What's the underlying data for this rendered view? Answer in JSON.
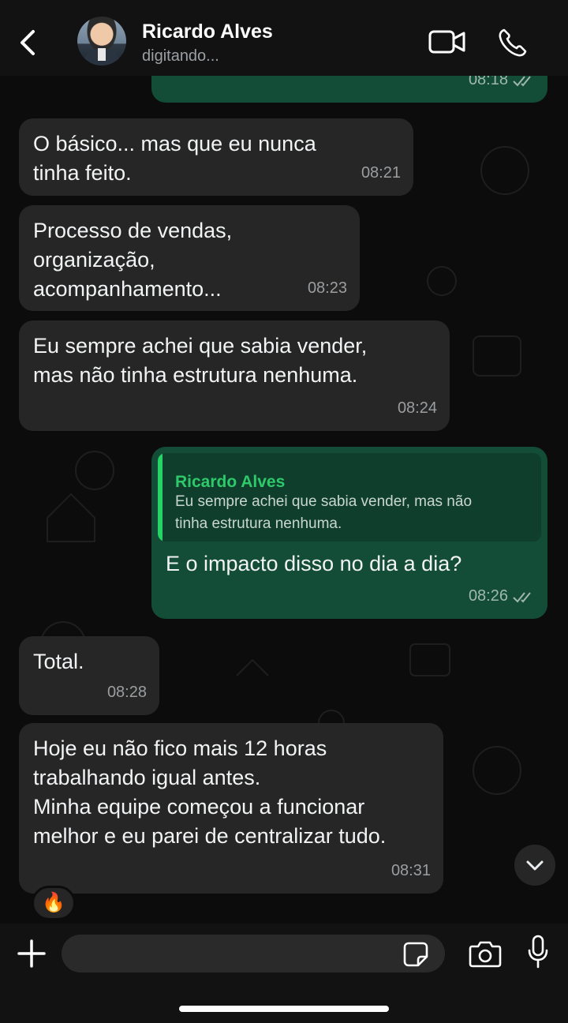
{
  "header": {
    "contact_name": "Ricardo Alves",
    "status": "digitando..."
  },
  "messages": [
    {
      "direction": "outgoing",
      "time": "08:18",
      "status": "read"
    },
    {
      "direction": "incoming",
      "lines": [
        "O básico... mas que eu nunca",
        "tinha feito."
      ],
      "time": "08:21"
    },
    {
      "direction": "incoming",
      "lines": [
        "Processo de vendas,",
        "organização,",
        "acompanhamento..."
      ],
      "time": "08:23"
    },
    {
      "direction": "incoming",
      "lines": [
        "Eu sempre achei que sabia vender,",
        "mas não tinha estrutura nenhuma."
      ],
      "time": "08:24"
    },
    {
      "direction": "outgoing",
      "quote": {
        "author": "Ricardo Alves",
        "lines": [
          "Eu sempre achei que sabia vender, mas não",
          "tinha estrutura nenhuma."
        ]
      },
      "text": "E o impacto disso no dia a dia?",
      "time": "08:26",
      "status": "read"
    },
    {
      "direction": "incoming",
      "text": "Total.",
      "time": "08:28"
    },
    {
      "direction": "incoming",
      "lines": [
        "Hoje eu não fico mais 12 horas",
        "trabalhando igual antes.",
        "Minha equipe começou a funcionar",
        "melhor e eu parei de centralizar tudo."
      ],
      "time": "08:31",
      "reaction": "🔥"
    }
  ],
  "composer": {
    "placeholder": ""
  },
  "colors": {
    "incoming_bubble": "#262626",
    "outgoing_bubble": "#144d37",
    "accent": "#25d366",
    "background": "#0c0c0c"
  },
  "icons": [
    "back-arrow-icon",
    "video-call-icon",
    "phone-icon",
    "chevron-down-icon",
    "plus-icon",
    "sticker-icon",
    "camera-icon",
    "microphone-icon",
    "double-check-icon"
  ]
}
